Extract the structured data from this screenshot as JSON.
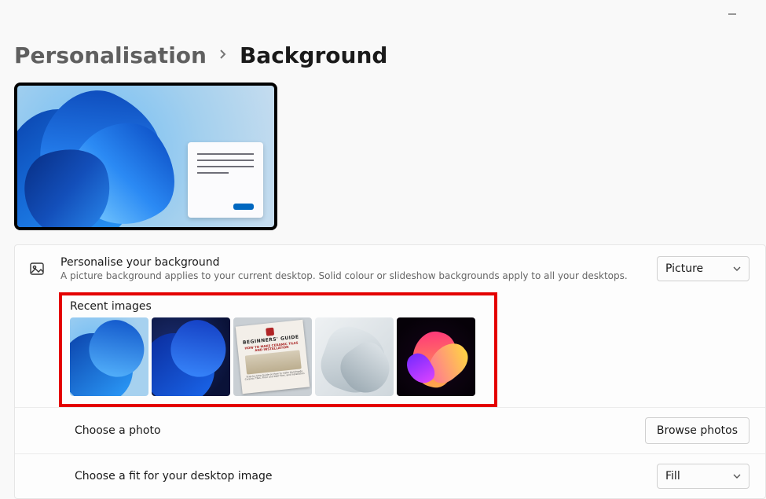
{
  "breadcrumb": {
    "parent": "Personalisation",
    "current": "Background"
  },
  "personalise": {
    "title": "Personalise your background",
    "subtitle": "A picture background applies to your current desktop. Solid colour or slideshow backgrounds apply to all your desktops.",
    "dropdown_value": "Picture"
  },
  "recent": {
    "label": "Recent images",
    "items": [
      {
        "name": "bloom-light"
      },
      {
        "name": "bloom-dark"
      },
      {
        "name": "beginners-guide"
      },
      {
        "name": "paper-swirl"
      },
      {
        "name": "neon-bloom"
      }
    ]
  },
  "guide_thumb": {
    "line1": "BEGINNERS' GUIDE",
    "line2": "HOW TO MAKE CERAMIC TILES AND INSTALLATION",
    "line3": "Step-by-Step Guide on How to make Handmade Ceramic Tiles, Floor and Wall Tiles, and Installation"
  },
  "choose_photo": {
    "label": "Choose a photo",
    "button": "Browse photos"
  },
  "choose_fit": {
    "label": "Choose a fit for your desktop image",
    "dropdown_value": "Fill"
  }
}
